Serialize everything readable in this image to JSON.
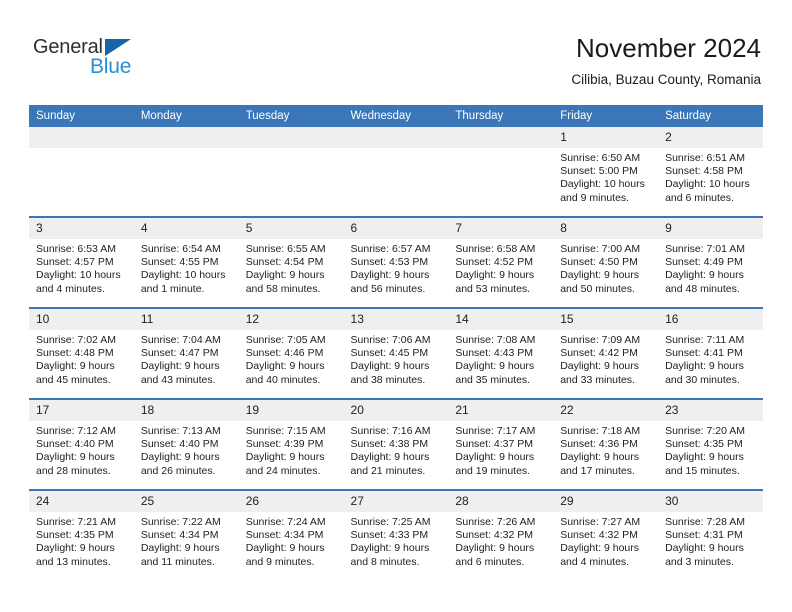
{
  "brand": {
    "name_top": "General",
    "name_bottom": "Blue",
    "triangle_icon": "triangle-icon",
    "color_dark": "#2f2f2f",
    "color_blue": "#2b8fd8"
  },
  "header": {
    "title": "November 2024",
    "subtitle": "Cilibia, Buzau County, Romania"
  },
  "theme": {
    "header_blue": "#3a76b8",
    "daynum_band": "#efeff0",
    "text": "#222222"
  },
  "weekdays": [
    "Sunday",
    "Monday",
    "Tuesday",
    "Wednesday",
    "Thursday",
    "Friday",
    "Saturday"
  ],
  "weeks": [
    [
      {
        "day": "",
        "empty": true
      },
      {
        "day": "",
        "empty": true
      },
      {
        "day": "",
        "empty": true
      },
      {
        "day": "",
        "empty": true
      },
      {
        "day": "",
        "empty": true
      },
      {
        "day": "1",
        "sunrise": "Sunrise: 6:50 AM",
        "sunset": "Sunset: 5:00 PM",
        "daylight": "Daylight: 10 hours and 9 minutes."
      },
      {
        "day": "2",
        "sunrise": "Sunrise: 6:51 AM",
        "sunset": "Sunset: 4:58 PM",
        "daylight": "Daylight: 10 hours and 6 minutes."
      }
    ],
    [
      {
        "day": "3",
        "sunrise": "Sunrise: 6:53 AM",
        "sunset": "Sunset: 4:57 PM",
        "daylight": "Daylight: 10 hours and 4 minutes."
      },
      {
        "day": "4",
        "sunrise": "Sunrise: 6:54 AM",
        "sunset": "Sunset: 4:55 PM",
        "daylight": "Daylight: 10 hours and 1 minute."
      },
      {
        "day": "5",
        "sunrise": "Sunrise: 6:55 AM",
        "sunset": "Sunset: 4:54 PM",
        "daylight": "Daylight: 9 hours and 58 minutes."
      },
      {
        "day": "6",
        "sunrise": "Sunrise: 6:57 AM",
        "sunset": "Sunset: 4:53 PM",
        "daylight": "Daylight: 9 hours and 56 minutes."
      },
      {
        "day": "7",
        "sunrise": "Sunrise: 6:58 AM",
        "sunset": "Sunset: 4:52 PM",
        "daylight": "Daylight: 9 hours and 53 minutes."
      },
      {
        "day": "8",
        "sunrise": "Sunrise: 7:00 AM",
        "sunset": "Sunset: 4:50 PM",
        "daylight": "Daylight: 9 hours and 50 minutes."
      },
      {
        "day": "9",
        "sunrise": "Sunrise: 7:01 AM",
        "sunset": "Sunset: 4:49 PM",
        "daylight": "Daylight: 9 hours and 48 minutes."
      }
    ],
    [
      {
        "day": "10",
        "sunrise": "Sunrise: 7:02 AM",
        "sunset": "Sunset: 4:48 PM",
        "daylight": "Daylight: 9 hours and 45 minutes."
      },
      {
        "day": "11",
        "sunrise": "Sunrise: 7:04 AM",
        "sunset": "Sunset: 4:47 PM",
        "daylight": "Daylight: 9 hours and 43 minutes."
      },
      {
        "day": "12",
        "sunrise": "Sunrise: 7:05 AM",
        "sunset": "Sunset: 4:46 PM",
        "daylight": "Daylight: 9 hours and 40 minutes."
      },
      {
        "day": "13",
        "sunrise": "Sunrise: 7:06 AM",
        "sunset": "Sunset: 4:45 PM",
        "daylight": "Daylight: 9 hours and 38 minutes."
      },
      {
        "day": "14",
        "sunrise": "Sunrise: 7:08 AM",
        "sunset": "Sunset: 4:43 PM",
        "daylight": "Daylight: 9 hours and 35 minutes."
      },
      {
        "day": "15",
        "sunrise": "Sunrise: 7:09 AM",
        "sunset": "Sunset: 4:42 PM",
        "daylight": "Daylight: 9 hours and 33 minutes."
      },
      {
        "day": "16",
        "sunrise": "Sunrise: 7:11 AM",
        "sunset": "Sunset: 4:41 PM",
        "daylight": "Daylight: 9 hours and 30 minutes."
      }
    ],
    [
      {
        "day": "17",
        "sunrise": "Sunrise: 7:12 AM",
        "sunset": "Sunset: 4:40 PM",
        "daylight": "Daylight: 9 hours and 28 minutes."
      },
      {
        "day": "18",
        "sunrise": "Sunrise: 7:13 AM",
        "sunset": "Sunset: 4:40 PM",
        "daylight": "Daylight: 9 hours and 26 minutes."
      },
      {
        "day": "19",
        "sunrise": "Sunrise: 7:15 AM",
        "sunset": "Sunset: 4:39 PM",
        "daylight": "Daylight: 9 hours and 24 minutes."
      },
      {
        "day": "20",
        "sunrise": "Sunrise: 7:16 AM",
        "sunset": "Sunset: 4:38 PM",
        "daylight": "Daylight: 9 hours and 21 minutes."
      },
      {
        "day": "21",
        "sunrise": "Sunrise: 7:17 AM",
        "sunset": "Sunset: 4:37 PM",
        "daylight": "Daylight: 9 hours and 19 minutes."
      },
      {
        "day": "22",
        "sunrise": "Sunrise: 7:18 AM",
        "sunset": "Sunset: 4:36 PM",
        "daylight": "Daylight: 9 hours and 17 minutes."
      },
      {
        "day": "23",
        "sunrise": "Sunrise: 7:20 AM",
        "sunset": "Sunset: 4:35 PM",
        "daylight": "Daylight: 9 hours and 15 minutes."
      }
    ],
    [
      {
        "day": "24",
        "sunrise": "Sunrise: 7:21 AM",
        "sunset": "Sunset: 4:35 PM",
        "daylight": "Daylight: 9 hours and 13 minutes."
      },
      {
        "day": "25",
        "sunrise": "Sunrise: 7:22 AM",
        "sunset": "Sunset: 4:34 PM",
        "daylight": "Daylight: 9 hours and 11 minutes."
      },
      {
        "day": "26",
        "sunrise": "Sunrise: 7:24 AM",
        "sunset": "Sunset: 4:34 PM",
        "daylight": "Daylight: 9 hours and 9 minutes."
      },
      {
        "day": "27",
        "sunrise": "Sunrise: 7:25 AM",
        "sunset": "Sunset: 4:33 PM",
        "daylight": "Daylight: 9 hours and 8 minutes."
      },
      {
        "day": "28",
        "sunrise": "Sunrise: 7:26 AM",
        "sunset": "Sunset: 4:32 PM",
        "daylight": "Daylight: 9 hours and 6 minutes."
      },
      {
        "day": "29",
        "sunrise": "Sunrise: 7:27 AM",
        "sunset": "Sunset: 4:32 PM",
        "daylight": "Daylight: 9 hours and 4 minutes."
      },
      {
        "day": "30",
        "sunrise": "Sunrise: 7:28 AM",
        "sunset": "Sunset: 4:31 PM",
        "daylight": "Daylight: 9 hours and 3 minutes."
      }
    ]
  ]
}
